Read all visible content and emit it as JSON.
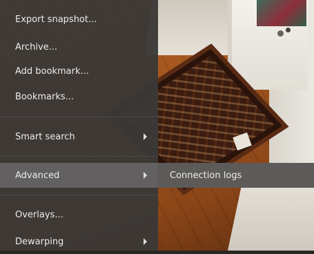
{
  "menu": {
    "items": [
      {
        "label": "Export snapshot...",
        "submenu": false
      },
      {
        "label": "Archive...",
        "submenu": false
      },
      {
        "label": "Add bookmark...",
        "submenu": false
      },
      {
        "label": "Bookmarks...",
        "submenu": false
      },
      {
        "label": "Smart search",
        "submenu": true
      },
      {
        "label": "Advanced",
        "submenu": true,
        "highlighted": true
      },
      {
        "label": "Overlays...",
        "submenu": false
      },
      {
        "label": "Dewarping",
        "submenu": true
      }
    ]
  },
  "submenu": {
    "parent": "Advanced",
    "items": [
      {
        "label": "Connection logs"
      }
    ]
  },
  "colors": {
    "menu_bg": "#3a3836",
    "highlight": "#626060",
    "submenu_bg": "#5d5b59",
    "text": "#ececec"
  }
}
